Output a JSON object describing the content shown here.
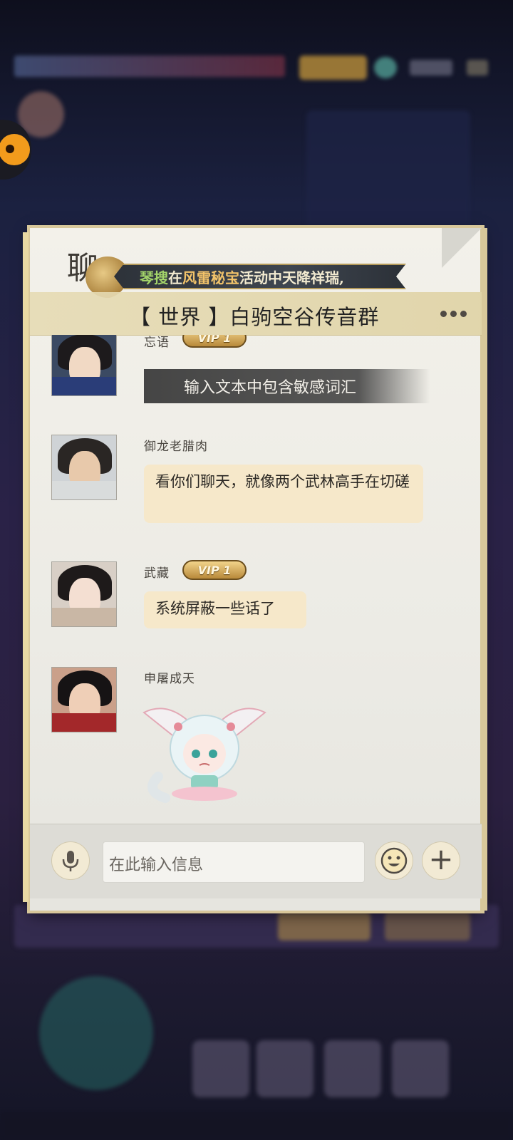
{
  "background": {
    "accent": "#2a2247"
  },
  "chat": {
    "header_char": "聊",
    "ribbon": {
      "part1": "琴搜",
      "part2": "在",
      "part3": "风雷秘宝",
      "part4": "活动中天降祥瑞,"
    },
    "title": "【 世界 】白驹空谷传音群",
    "more_icon": "more-dots-icon"
  },
  "messages": [
    {
      "name": "忘语",
      "vip": "VIP 1",
      "system_notice": "输入文本中包含敏感词汇"
    },
    {
      "name": "御龙老腊肉",
      "text": "看你们聊天，就像两个武林高手在切磋"
    },
    {
      "name": "武藏",
      "vip": "VIP 1",
      "text": "系统屏蔽一些话了"
    },
    {
      "name": "申屠成天",
      "sticker": "crying-fox-girl-sticker"
    }
  ],
  "input": {
    "placeholder": "在此输入信息",
    "voice_icon": "microphone-icon",
    "emoji_icon": "emoji-face-icon",
    "add_icon": "plus-icon"
  }
}
